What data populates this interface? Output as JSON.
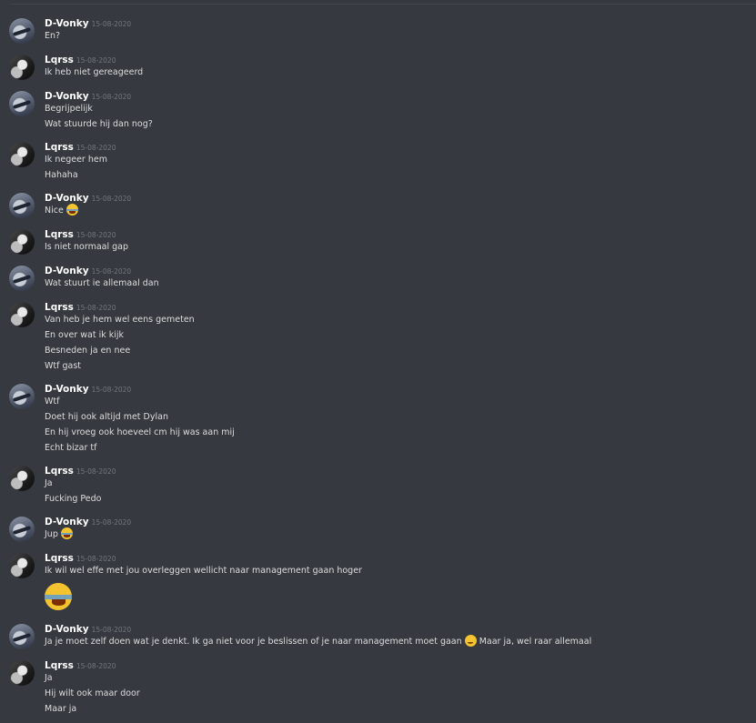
{
  "colors": {
    "background": "#36393f",
    "username": "#ffffff",
    "timestamp": "#72767d",
    "message_text": "#dcddde"
  },
  "messages": [
    {
      "author": "D-Vonky",
      "avatar": "dvonky",
      "timestamp": "15-08-2020",
      "lines": [
        {
          "text": "En?"
        }
      ]
    },
    {
      "author": "Lqrss",
      "avatar": "lqrss",
      "timestamp": "15-08-2020",
      "lines": [
        {
          "text": "Ik heb niet gereageerd"
        }
      ]
    },
    {
      "author": "D-Vonky",
      "avatar": "dvonky",
      "timestamp": "15-08-2020",
      "lines": [
        {
          "text": "Begrijpelijk"
        },
        {
          "text": "Wat stuurde hij dan nog?"
        }
      ]
    },
    {
      "author": "Lqrss",
      "avatar": "lqrss",
      "timestamp": "15-08-2020",
      "lines": [
        {
          "text": "Ik negeer hem"
        },
        {
          "text": "Hahaha"
        }
      ]
    },
    {
      "author": "D-Vonky",
      "avatar": "dvonky",
      "timestamp": "15-08-2020",
      "lines": [
        {
          "text": "Nice",
          "emoji": "joy-emoji"
        }
      ]
    },
    {
      "author": "Lqrss",
      "avatar": "lqrss",
      "timestamp": "15-08-2020",
      "lines": [
        {
          "text": "Is niet normaal gap"
        }
      ]
    },
    {
      "author": "D-Vonky",
      "avatar": "dvonky",
      "timestamp": "15-08-2020",
      "lines": [
        {
          "text": "Wat stuurt ie allemaal dan"
        }
      ]
    },
    {
      "author": "Lqrss",
      "avatar": "lqrss",
      "timestamp": "15-08-2020",
      "lines": [
        {
          "text": "Van heb je hem wel eens gemeten"
        },
        {
          "text": "En over wat ik kijk"
        },
        {
          "text": "Besneden ja en nee"
        },
        {
          "text": "Wtf gast"
        }
      ]
    },
    {
      "author": "D-Vonky",
      "avatar": "dvonky",
      "timestamp": "15-08-2020",
      "lines": [
        {
          "text": "Wtf"
        },
        {
          "text": "Doet hij ook altijd met Dylan"
        },
        {
          "text": "En hij vroeg ook hoeveel cm hij was aan mij"
        },
        {
          "text": "Echt bizar tf"
        }
      ]
    },
    {
      "author": "Lqrss",
      "avatar": "lqrss",
      "timestamp": "15-08-2020",
      "lines": [
        {
          "text": "Ja"
        },
        {
          "text": "Fucking Pedo"
        }
      ]
    },
    {
      "author": "D-Vonky",
      "avatar": "dvonky",
      "timestamp": "15-08-2020",
      "lines": [
        {
          "text": "Jup",
          "emoji": "joy-emoji"
        }
      ]
    },
    {
      "author": "Lqrss",
      "avatar": "lqrss",
      "timestamp": "15-08-2020",
      "lines": [
        {
          "text": "Ik wil wel effe met jou overleggen wellicht naar management gaan hoger"
        },
        {
          "text": "",
          "big_emoji": "joy-emoji"
        }
      ]
    },
    {
      "author": "D-Vonky",
      "avatar": "dvonky",
      "timestamp": "15-08-2020",
      "lines": [
        {
          "text": "Ja je moet zelf doen wat je denkt. Ik ga niet voor je beslissen of je naar management moet gaan",
          "emoji": "wink-emoji",
          "after": "Maar ja, wel raar allemaal"
        }
      ]
    },
    {
      "author": "Lqrss",
      "avatar": "lqrss",
      "timestamp": "15-08-2020",
      "lines": [
        {
          "text": "Ja"
        },
        {
          "text": "Hij wilt ook maar door"
        },
        {
          "text": "Maar ja"
        }
      ]
    }
  ]
}
